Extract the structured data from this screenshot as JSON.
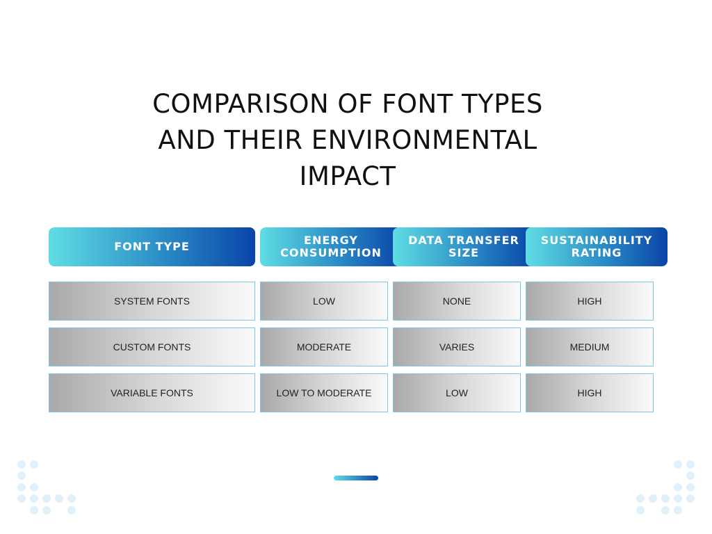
{
  "title": {
    "line1": "COMPARISON OF FONT TYPES",
    "line2": "AND THEIR ENVIRONMENTAL",
    "line3": "IMPACT"
  },
  "table": {
    "headers": [
      "FONT TYPE",
      "ENERGY CONSUMPTION",
      "DATA TRANSFER SIZE",
      "SUSTAINABILITY RATING"
    ],
    "rows": [
      [
        "SYSTEM FONTS",
        "LOW",
        "NONE",
        "HIGH"
      ],
      [
        "CUSTOM FONTS",
        "MODERATE",
        "VARIES",
        "MEDIUM"
      ],
      [
        "VARIABLE FONTS",
        "LOW TO MODERATE",
        "LOW",
        "HIGH"
      ]
    ]
  },
  "colors": {
    "header_gradient_start": "#5fdde3",
    "header_gradient_end": "#0a44a8",
    "cell_border": "#7cc6ee",
    "dot_color": "#e0f1fc"
  }
}
